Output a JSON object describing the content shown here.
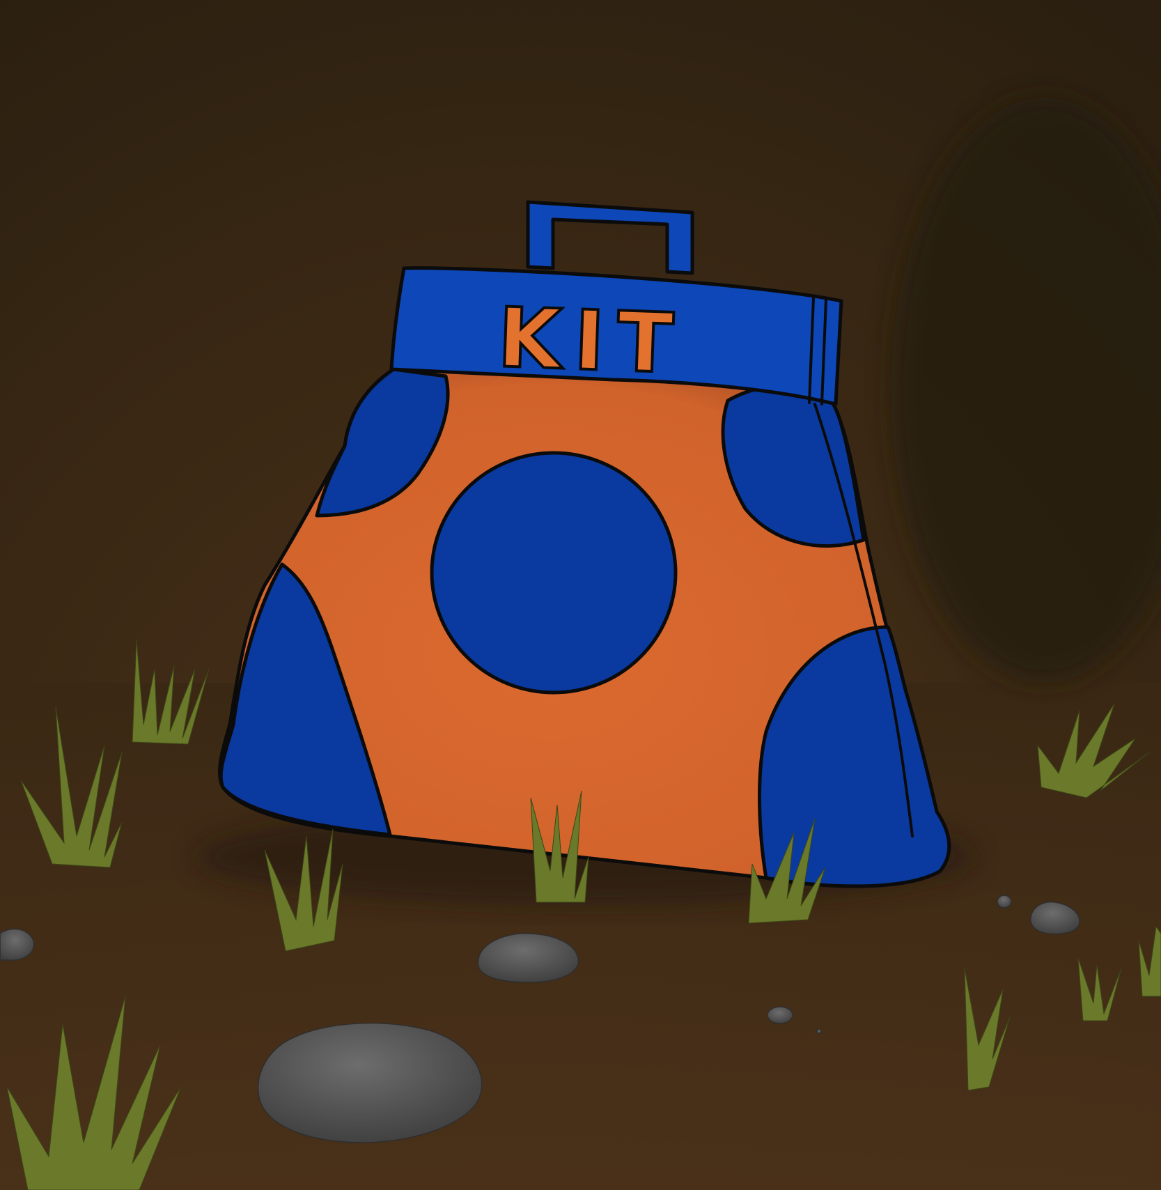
{
  "scene": {
    "description_free": true,
    "bag": {
      "label": "KIT",
      "colors": {
        "body_orange": "#d8682e",
        "body_blue": "#0a3aa0",
        "band_blue": "#0d47b8",
        "label_orange": "#e4722f",
        "outline": "#0b0b0b"
      }
    },
    "background": {
      "colors": {
        "dark_top": "#2d2211",
        "mid_brown": "#3d2a15",
        "ground": "#4a3018"
      }
    },
    "rocks": {
      "color": "#5a5a5a"
    },
    "grass": {
      "color": "#6a7a2a"
    }
  }
}
